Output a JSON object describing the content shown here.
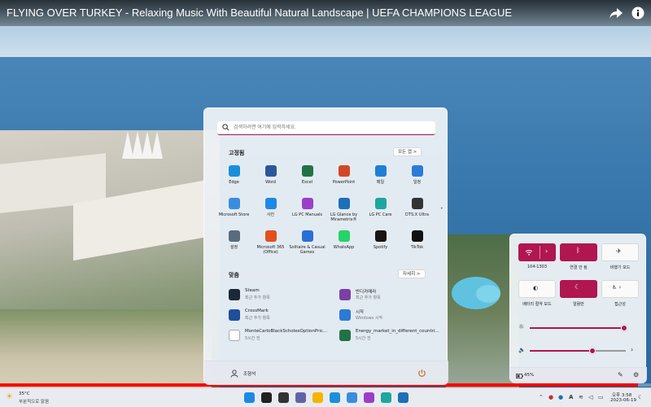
{
  "video": {
    "title": "FLYING OVER TURKEY - Relaxing Music With Beautiful Natural Landscape | UEFA CHAMPIONS LEAGUE",
    "progress_fraction": 0.98
  },
  "start_menu": {
    "search_placeholder": "검색하려면 여기에 입력하세요.",
    "pinned_title": "고정됨",
    "all_apps_label": "모든 앱 >",
    "pinned_apps": [
      {
        "label": "Edge",
        "icon": "edge-icon",
        "color": "#1a8fd9"
      },
      {
        "label": "Word",
        "icon": "word-icon",
        "color": "#2b579a"
      },
      {
        "label": "Excel",
        "icon": "excel-icon",
        "color": "#217346"
      },
      {
        "label": "PowerPoint",
        "icon": "powerpoint-icon",
        "color": "#d24726"
      },
      {
        "label": "메일",
        "icon": "mail-icon",
        "color": "#1f7fd6"
      },
      {
        "label": "일정",
        "icon": "calendar-icon",
        "color": "#2b7bd9"
      },
      {
        "label": "Microsoft Store",
        "icon": "store-icon",
        "color": "#3a8dde"
      },
      {
        "label": "사진",
        "icon": "photos-icon",
        "color": "#1e88e5"
      },
      {
        "label": "LG PC Manuals",
        "icon": "manuals-icon",
        "color": "#9b3fc8"
      },
      {
        "label": "LG Glance by Mirametrix®",
        "icon": "glance-icon",
        "color": "#1d6fb8"
      },
      {
        "label": "LG PC Care",
        "icon": "pc-care-icon",
        "color": "#1fa6a0"
      },
      {
        "label": "DTS:X Ultra",
        "icon": "dts-icon",
        "color": "#333333"
      },
      {
        "label": "설정",
        "icon": "settings-icon",
        "color": "#5a6b7d"
      },
      {
        "label": "Microsoft 365 (Office)",
        "icon": "office-icon",
        "color": "#e1501c"
      },
      {
        "label": "Solitaire & Casual Games",
        "icon": "solitaire-icon",
        "color": "#2a6fd6"
      },
      {
        "label": "WhatsApp",
        "icon": "whatsapp-icon",
        "color": "#25d366"
      },
      {
        "label": "Spotify",
        "icon": "spotify-icon",
        "color": "#191414"
      },
      {
        "label": "TikTok",
        "icon": "tiktok-icon",
        "color": "#111111"
      }
    ],
    "recommended_title": "맞춤",
    "more_label": "자세히 >",
    "recommended": [
      {
        "name": "Steam",
        "sub": "최근 추가 항목",
        "icon": "steam-icon",
        "color": "#1b2838"
      },
      {
        "name": "반디카메라",
        "sub": "최근 추가 항목",
        "icon": "bandicam-icon",
        "color": "#7b3fa8"
      },
      {
        "name": "CrossMark",
        "sub": "최근 추가 항목",
        "icon": "crossmark-icon",
        "color": "#1f4f9a"
      },
      {
        "name": "시작",
        "sub": "Windows 시작",
        "icon": "tips-icon",
        "color": "#2a7ad6"
      },
      {
        "name": "MonteCarloBlackScholesOptionPric...",
        "sub": "5시간 전",
        "icon": "file-icon",
        "color": "#ffffff"
      },
      {
        "name": "Energy_market_in_different_countri...",
        "sub": "5시간 전",
        "icon": "excel-file-icon",
        "color": "#217346"
      }
    ],
    "user_name": "조형석"
  },
  "quick_settings": {
    "wifi_label": "104-1303",
    "bluetooth_label": "연결 안 됨",
    "airplane_label": "비행기 모드",
    "battery_saver_label": "배터리 절약 모드",
    "focus_label": "알람만",
    "accessibility_label": "접근성",
    "brightness_fraction": 0.98,
    "volume_fraction": 0.65,
    "battery_text": "45%",
    "accent_color": "#b0164f"
  },
  "taskbar": {
    "weather_temp": "35°C",
    "weather_desc": "부분적으로 맑음",
    "clock_time": "오후 3:58",
    "clock_date": "2023-06-19",
    "ime": "A",
    "apps": [
      {
        "icon": "start-icon",
        "color": "#1e88e5"
      },
      {
        "icon": "search-icon",
        "color": "#222222"
      },
      {
        "icon": "task-view-icon",
        "color": "#333333"
      },
      {
        "icon": "chat-icon",
        "color": "#6264a7"
      },
      {
        "icon": "file-explorer-icon",
        "color": "#f4b400"
      },
      {
        "icon": "edge-icon",
        "color": "#1a8fd9"
      },
      {
        "icon": "store-icon",
        "color": "#3a8dde"
      },
      {
        "icon": "app-icon",
        "color": "#9b3fc8"
      },
      {
        "icon": "pc-care-icon",
        "color": "#1fa6a0"
      },
      {
        "icon": "glance-icon",
        "color": "#1d6fb8"
      }
    ]
  }
}
